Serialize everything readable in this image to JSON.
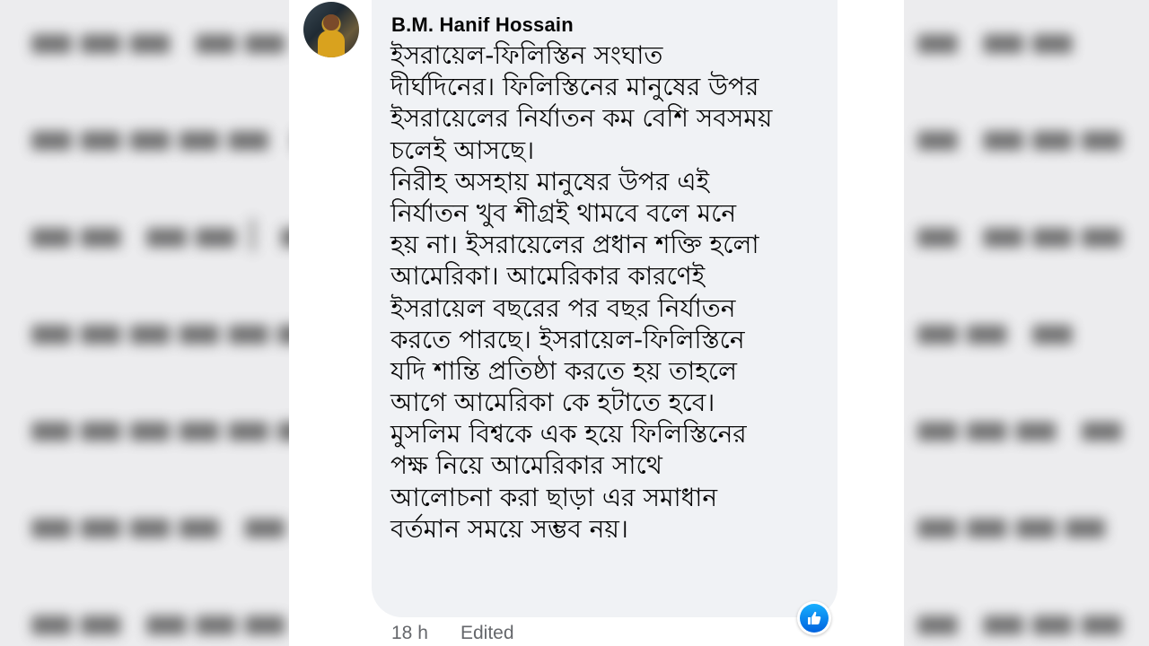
{
  "comment": {
    "author": "B.M. Hanif Hossain",
    "lines": [
      "ইসরায়েল-ফিলিস্তিন সংঘাত",
      "দীর্ঘদিনের। ফিলিস্তিনের মানুষের উপর",
      "ইসরায়েলের নির্যাতন কম বেশি সবসময়",
      "চলেই আসছে।",
      "নিরীহ অসহায় মানুষের উপর এই",
      "নির্যাতন খুব শীগ্রই থামবে বলে মনে",
      "হয় না। ইসরায়েলের প্রধান শক্তি হলো",
      "আমেরিকা। আমেরিকার কারণেই",
      "ইসরায়েল বছরের পর বছর নির্যাতন",
      "করতে পারছে। ইসরায়েল-ফিলিস্তিনে",
      "যদি শান্তি প্রতিষ্ঠা করতে হয় তাহলে",
      "আগে আমেরিকা কে হটাতে হবে।",
      "মুসলিম বিশ্বকে এক হয়ে ফিলিস্তিনের",
      "পক্ষ নিয়ে আমেরিকার সাথে",
      "আলোচনা করা ছাড়া এর সমাধান",
      "বর্তমান সময়ে সম্ভব নয়।"
    ],
    "time": "18 h",
    "edited_label": "Edited",
    "reaction_icon": "like-icon"
  },
  "colors": {
    "bubble": "#f0f2f5",
    "text": "#050505",
    "meta": "#65676b",
    "like": "#1877f2"
  }
}
